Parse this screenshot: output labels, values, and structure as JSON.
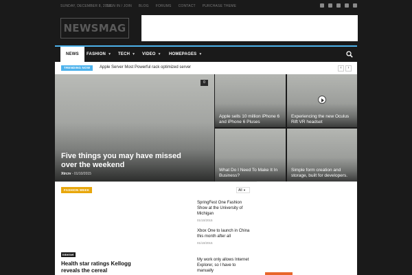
{
  "topbar": {
    "date": "SUNDAY, DECEMBER 8, 2019",
    "menu": [
      "SIGN IN / JOIN",
      "BLOG",
      "FORUMS",
      "CONTACT",
      "PURCHASE THEME"
    ]
  },
  "header": {
    "logo": "NEWSMAG"
  },
  "nav": {
    "items": [
      {
        "label": "NEWS",
        "active": true
      },
      {
        "label": "FASHION"
      },
      {
        "label": "TECH"
      },
      {
        "label": "VIDEO"
      },
      {
        "label": "HOMEPAGES"
      }
    ],
    "accent": "#4db2ec"
  },
  "trending": {
    "badge": "TRENDING NOW",
    "title": "Apple Server Most Powerful rack optimized server",
    "prev": "‹",
    "next": "›"
  },
  "featured": {
    "big": {
      "title": "Five things you may have missed over the weekend",
      "author": "Xtrcrv",
      "date": "01/10/2015",
      "comments": "0"
    },
    "tiles": [
      {
        "title": "Apple sells 10 million iPhone 6 and iPhone 6 Pluses"
      },
      {
        "title": "Experiencing the new Oculus Rift VR headset"
      },
      {
        "title": "What Do I Need To Make It In Business?"
      },
      {
        "title": "Simple form creation and storage, built for developers."
      }
    ]
  },
  "fashion_week": {
    "label": "FASHION WEEK",
    "filter": "All",
    "main": {
      "tag": "Internet",
      "title": "Health star ratings Kellogg reveals the cereal"
    },
    "side": [
      {
        "title": "SpringFest One Fashion Show at the University of Michigan",
        "date": "01/10/2015"
      },
      {
        "title": "Xbox One to launch in China this month after all",
        "date": "01/10/2015"
      },
      {
        "title": "My work only allows Internet Explorer, so I have to manually",
        "date": ""
      }
    ]
  },
  "colors": {
    "tag_orange": "#e8a70c",
    "bottom_orange": "#e8662a"
  }
}
